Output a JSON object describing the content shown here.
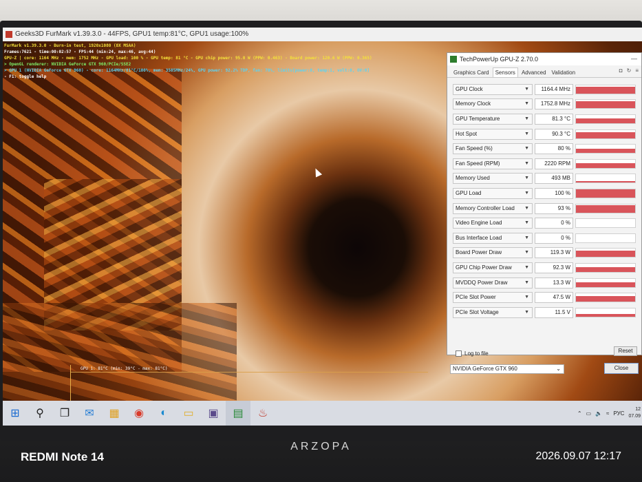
{
  "window_title": "Geeks3D FurMark v1.39.3.0 - 44FPS, GPU1 temp:81°C, GPU1 usage:100%",
  "furmark_osd": [
    {
      "text": "FurMark v1.39.3.0 - Burn-in test, 1920x1080 (8X MSAA)",
      "color": "y"
    },
    {
      "text": "Frames:7621 - time:00:02:57 - FPS:44 (min:24, max:46, avg:44)",
      "color": "w"
    },
    {
      "text": "GPU-Z | core: 1164 MHz - mem: 1752 MHz - GPU load: 100 % - GPU temp: 81 °C - GPU chip power: 95.0 W (PPW: 0.463) - Board power: 120.6 W (PPW: 0.365)",
      "color": "y"
    },
    {
      "text": "> OpenGL renderer: NVIDIA GeForce GTX 960/PCIe/SSE2",
      "color": "g"
    },
    {
      "text": "> GPU 1 (NVIDIA GeForce GTX 960) - core: 1164MHz/81°C/100%, mem: 3505MHz/24%, GPU power: 92.2% TDP, fan: 70%, limits[power:0, temp:1, volt:0, OV:0]",
      "color": "c"
    },
    {
      "text": "- F1: toggle help",
      "color": "w"
    }
  ],
  "graph_label": "GPU 1: 81°C (min: 39°C - max: 81°C)",
  "gpuz": {
    "title": "TechPowerUp GPU-Z 2.70.0",
    "tabs": [
      "Graphics Card",
      "Sensors",
      "Advanced",
      "Validation"
    ],
    "active_tab": "Sensors",
    "sensors": [
      {
        "name": "GPU Clock",
        "value": "1164.4 MHz",
        "level": 0.85
      },
      {
        "name": "Memory Clock",
        "value": "1752.8 MHz",
        "level": 0.85
      },
      {
        "name": "GPU Temperature",
        "value": "81.3 °C",
        "level": 0.6
      },
      {
        "name": "Hot Spot",
        "value": "90.3 °C",
        "level": 0.75
      },
      {
        "name": "Fan Speed (%)",
        "value": "80 %",
        "level": 0.55
      },
      {
        "name": "Fan Speed (RPM)",
        "value": "2220 RPM",
        "level": 0.6
      },
      {
        "name": "Memory Used",
        "value": "493 MB",
        "level": 0.2
      },
      {
        "name": "GPU Load",
        "value": "100 %",
        "level": 1.0
      },
      {
        "name": "Memory Controller Load",
        "value": "93 %",
        "level": 0.9
      },
      {
        "name": "Video Engine Load",
        "value": "0 %",
        "level": 0.0
      },
      {
        "name": "Bus Interface Load",
        "value": "0 %",
        "level": 0.0
      },
      {
        "name": "Board Power Draw",
        "value": "119.3 W",
        "level": 0.8
      },
      {
        "name": "GPU Chip Power Draw",
        "value": "92.3 W",
        "level": 0.6
      },
      {
        "name": "MVDDQ Power Draw",
        "value": "13.3 W",
        "level": 0.55
      },
      {
        "name": "PCIe Slot Power",
        "value": "47.5 W",
        "level": 0.7
      },
      {
        "name": "PCIe Slot Voltage",
        "value": "11.5 V",
        "level": 0.35
      }
    ],
    "log_label": "Log to file",
    "reset_label": "Reset",
    "gpu_select": "NVIDIA GeForce GTX 960",
    "close_label": "Close"
  },
  "taskbar": {
    "tray_lang": "РУС",
    "clock_time": "12",
    "clock_date": "07.09"
  },
  "monitor_brand": "ARZOPA",
  "camera_watermark": "REDMI Note 14",
  "photo_timestamp": "2026.09.07 12:17",
  "colors": {
    "sensor_bar": "#d9545a",
    "osd_yellow": "#f4e13a"
  }
}
